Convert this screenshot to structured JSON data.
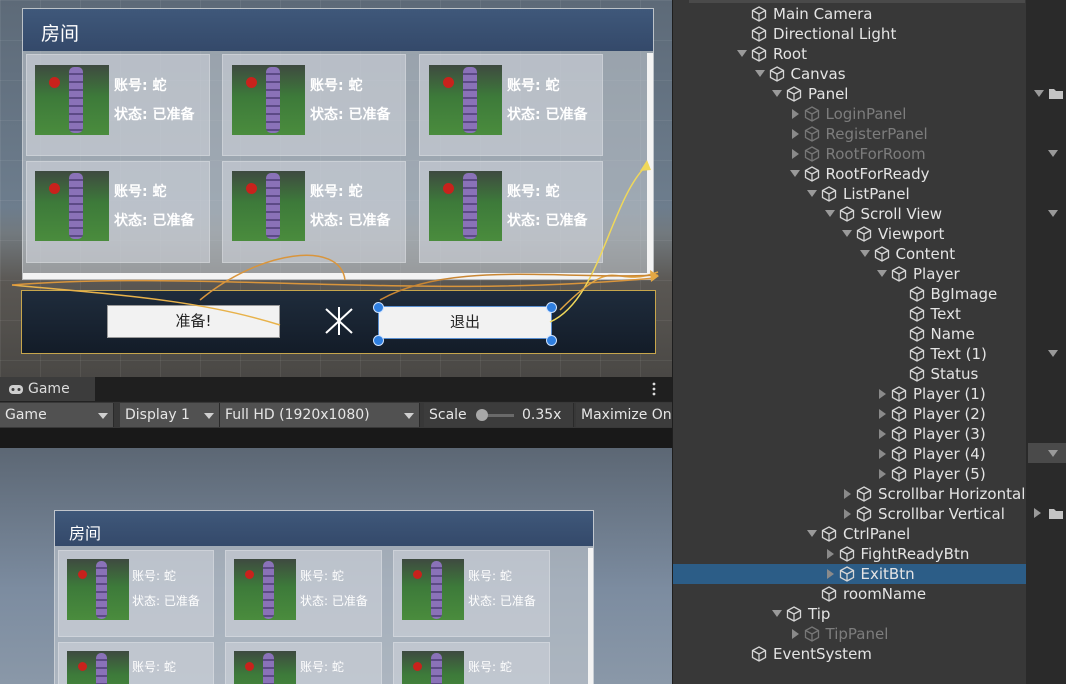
{
  "scene": {
    "panel_title": "房间",
    "cards_top": [
      {
        "account": "账号: 蛇",
        "status": "状态: 已准备"
      },
      {
        "account": "账号: 蛇",
        "status": "状态: 已准备"
      },
      {
        "account": "账号: 蛇",
        "status": "状态: 已准备"
      }
    ],
    "cards_bottom": [
      {
        "account": "账号: 蛇",
        "status": "状态: 已准备"
      },
      {
        "account": "账号: 蛇",
        "status": "状态: 已准备"
      },
      {
        "account": "账号: 蛇",
        "status": "状态: 已准备"
      }
    ],
    "ready_button": "准备!",
    "exit_button": "退出"
  },
  "game": {
    "tab_label": "Game",
    "toolbar": {
      "view_mode": "Game",
      "display": "Display 1",
      "resolution": "Full HD (1920x1080)",
      "scale_label": "Scale",
      "scale_value": "0.35x",
      "maximize": "Maximize On"
    },
    "panel_title": "房间",
    "cards_top": [
      {
        "account": "账号: 蛇",
        "status": "状态: 已准备"
      },
      {
        "account": "账号: 蛇",
        "status": "状态: 已准备"
      },
      {
        "account": "账号: 蛇",
        "status": "状态: 已准备"
      }
    ],
    "cards_bottom": [
      {
        "account": "账号: 蛇"
      },
      {
        "account": "账号: 蛇"
      },
      {
        "account": "账号: 蛇"
      }
    ]
  },
  "hierarchy": {
    "items": [
      {
        "name": "Main Camera"
      },
      {
        "name": "Directional Light"
      },
      {
        "name": "Root"
      },
      {
        "name": "Canvas"
      },
      {
        "name": "Panel"
      },
      {
        "name": "LoginPanel"
      },
      {
        "name": "RegisterPanel"
      },
      {
        "name": "RootForRoom"
      },
      {
        "name": "RootForReady"
      },
      {
        "name": "ListPanel"
      },
      {
        "name": "Scroll View"
      },
      {
        "name": "Viewport"
      },
      {
        "name": "Content"
      },
      {
        "name": "Player"
      },
      {
        "name": "BgImage"
      },
      {
        "name": "Text"
      },
      {
        "name": "Name"
      },
      {
        "name": "Text (1)"
      },
      {
        "name": "Status"
      },
      {
        "name": "Player (1)"
      },
      {
        "name": "Player (2)"
      },
      {
        "name": "Player (3)"
      },
      {
        "name": "Player (4)"
      },
      {
        "name": "Player (5)"
      },
      {
        "name": "Scrollbar Horizontal"
      },
      {
        "name": "Scrollbar Vertical"
      },
      {
        "name": "CtrlPanel"
      },
      {
        "name": "FightReadyBtn"
      },
      {
        "name": "ExitBtn"
      },
      {
        "name": "roomName"
      },
      {
        "name": "Tip"
      },
      {
        "name": "TipPanel"
      },
      {
        "name": "EventSystem"
      }
    ]
  }
}
